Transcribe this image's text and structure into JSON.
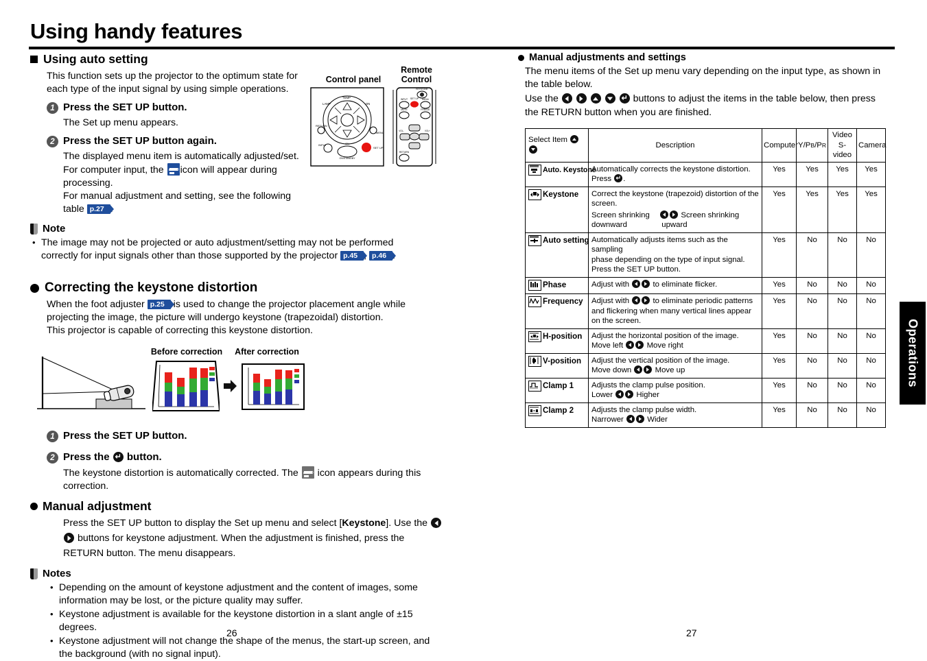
{
  "document": {
    "title": "Using handy features",
    "side_tab": "Operations",
    "page_left": "26",
    "page_right": "27"
  },
  "left": {
    "section1": {
      "heading": "Using auto setting",
      "intro": "This function sets up the projector to the optimum state for each type of the input signal by using simple operations.",
      "step1": {
        "num": "1",
        "title": "Press the SET UP button.",
        "body": "The Set up menu appears."
      },
      "step2": {
        "num": "2",
        "title": "Press the SET UP button again.",
        "body_a": "The displayed menu item is automatically adjusted/set.",
        "body_b1": "For computer input, the",
        "body_b2": "icon will appear during",
        "body_c": "processing.",
        "body_d1": "For manual adjustment and setting, see the following table",
        "body_d_ref": "p.27",
        "body_d2": "."
      },
      "note_label": "Note",
      "note_item_a": "The image may not be projected or auto adjustment/setting may not be performed correctly for input signals other than those supported by the projector",
      "note_ref_1": "p.45",
      "note_ref_sep": ",",
      "note_ref_2": "p.46",
      "note_ref_end": "."
    },
    "illustration": {
      "control_panel_label_line1": "Control panel",
      "remote_label_line1": "Remote",
      "remote_label_line2": "Control"
    },
    "section2": {
      "heading": "Correcting the keystone distortion",
      "para_a1": "When the foot adjuster",
      "para_a_ref": "p.25",
      "para_a2": "is used to change the projector placement angle while projecting the image, the picture will undergo keystone (trapezoidal) distortion.",
      "para_b": "This projector is capable of correcting this keystone distortion.",
      "caption_before": "Before correction",
      "caption_after": "After correction",
      "step1": {
        "num": "1",
        "title": "Press the SET UP button."
      },
      "step2": {
        "num": "2",
        "title_a": "Press the",
        "title_b": "button.",
        "body_a": "The keystone distortion is automatically corrected. The",
        "body_b": "icon appears during this",
        "body_c": "correction."
      },
      "manual_heading": "Manual adjustment",
      "manual_a": "Press the SET UP button to display the Set up menu and select [",
      "manual_a_bold": "Keystone",
      "manual_a_end": "]. Use",
      "manual_b1": "the",
      "manual_b2": "buttons for keystone adjustment. When the adjustment is finished, press",
      "manual_c": "the RETURN button. The menu disappears.",
      "notes_label": "Notes",
      "notes": [
        "Depending on the amount of keystone adjustment and the content of images, some information may be lost, or the picture quality may suffer.",
        "Keystone adjustment is available for the keystone distortion in a slant angle of ±15 degrees.",
        "Keystone adjustment will not change the shape of the menus, the start-up screen, and the background (with no signal input)."
      ]
    }
  },
  "right": {
    "heading": "Manual adjustments and settings",
    "intro_a": "The menu items of the Set up menu vary depending on the input type, as shown in",
    "intro_b": "the table below.",
    "intro_c1": "Use the",
    "intro_c2": "buttons to adjust the items in the table below, then press",
    "intro_d": "the RETURN button when you are finished.",
    "table": {
      "headers": {
        "select_item": "Select Item",
        "description": "Description",
        "computer": "Computer",
        "ypbpr": "Y/PB/PR",
        "video_line1": "Video",
        "video_line2": "S-video",
        "camera": "Camera"
      },
      "rows": [
        {
          "icon": "auto-keystone-icon",
          "label": "Auto. Keystone",
          "label_thin": true,
          "desc_lines": [
            "Automatically corrects the keystone distortion."
          ],
          "desc_btn_prefix": "Press",
          "desc_btn_type": "enter",
          "desc_btn_suffix": ".",
          "computer": "Yes",
          "ypbpr": "Yes",
          "video": "Yes",
          "camera": "Yes"
        },
        {
          "icon": "keystone-icon",
          "label": "Keystone",
          "desc_lines": [
            "Correct the keystone (trapezoid) distortion of the",
            "screen."
          ],
          "pair_left": "Screen shrinking",
          "pair_right": "Screen shrinking",
          "pair_left2": "downward",
          "pair_right2": "upward",
          "computer": "Yes",
          "ypbpr": "Yes",
          "video": "Yes",
          "camera": "Yes"
        },
        {
          "icon": "auto-setting-icon",
          "label": "Auto setting",
          "desc_lines": [
            "Automatically adjusts items such as the sampling",
            "phase depending on the type of input signal.",
            "Press the SET UP button."
          ],
          "computer": "Yes",
          "ypbpr": "No",
          "video": "No",
          "camera": "No"
        },
        {
          "icon": "phase-icon",
          "label": "Phase",
          "desc_prefix": "Adjust with",
          "desc_suffix": "to eliminate flicker.",
          "computer": "Yes",
          "ypbpr": "No",
          "video": "No",
          "camera": "No"
        },
        {
          "icon": "frequency-icon",
          "label": "Frequency",
          "desc_prefix": "Adjust with",
          "desc_suffix": "to eliminate periodic patterns",
          "desc_lines": [
            "and flickering when many vertical lines appear",
            "on the screen."
          ],
          "computer": "Yes",
          "ypbpr": "No",
          "video": "No",
          "camera": "No"
        },
        {
          "icon": "h-position-icon",
          "label": "H-position",
          "desc_lines": [
            "Adjust the horizontal position of the image."
          ],
          "pair_left": "Move left",
          "pair_right": "Move right",
          "computer": "Yes",
          "ypbpr": "No",
          "video": "No",
          "camera": "No"
        },
        {
          "icon": "v-position-icon",
          "label": "V-position",
          "desc_lines": [
            "Adjust the vertical position of the image."
          ],
          "pair_left": "Move down",
          "pair_right": "Move up",
          "computer": "Yes",
          "ypbpr": "No",
          "video": "No",
          "camera": "No"
        },
        {
          "icon": "clamp1-icon",
          "label": "Clamp 1",
          "desc_lines": [
            "Adjusts the clamp pulse position."
          ],
          "pair_left": "Lower",
          "pair_right": "Higher",
          "computer": "Yes",
          "ypbpr": "No",
          "video": "No",
          "camera": "No"
        },
        {
          "icon": "clamp2-icon",
          "label": "Clamp 2",
          "desc_lines": [
            "Adjusts the clamp pulse width."
          ],
          "pair_left": "Narrower",
          "pair_right": "Wider",
          "computer": "Yes",
          "ypbpr": "No",
          "video": "No",
          "camera": "No"
        }
      ]
    }
  },
  "colors": {
    "accent_blue": "#1f4e9c",
    "remote_red": "#e8130f",
    "chart_red": "#e8231c",
    "chart_green": "#33aa33",
    "chart_blue": "#2b35a8"
  }
}
